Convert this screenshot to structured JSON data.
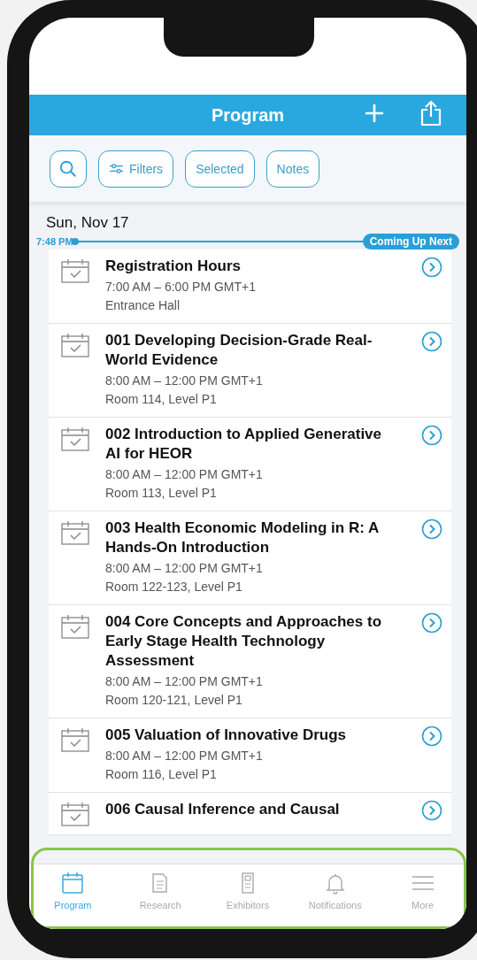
{
  "header": {
    "title": "Program"
  },
  "toolbar": {
    "buttons": [
      {
        "kind": "search"
      },
      {
        "kind": "filters",
        "label": "Filters"
      },
      {
        "kind": "plain",
        "label": "Selected"
      },
      {
        "kind": "plain",
        "label": "Notes"
      }
    ]
  },
  "date": "Sun, Nov 17",
  "now_marker": {
    "time": "7:48 PM",
    "label": "Coming Up Next"
  },
  "sessions": [
    {
      "title": "Registration Hours",
      "time": "7:00 AM – 6:00 PM GMT+1",
      "location": "Entrance Hall"
    },
    {
      "title": "001 Developing Decision-Grade Real-World Evidence",
      "time": "8:00 AM – 12:00 PM GMT+1",
      "location": "Room 114, Level P1"
    },
    {
      "title": "002 Introduction to Applied Generative AI for HEOR",
      "time": "8:00 AM – 12:00 PM GMT+1",
      "location": "Room 113, Level P1"
    },
    {
      "title": "003 Health Economic Modeling in R: A Hands-On Introduction",
      "time": "8:00 AM – 12:00 PM GMT+1",
      "location": "Room 122-123, Level P1"
    },
    {
      "title": "004 Core Concepts and Approaches to Early Stage Health Technology Assessment",
      "time": "8:00 AM – 12:00 PM GMT+1",
      "location": "Room 120-121, Level P1"
    },
    {
      "title": "005 Valuation of Innovative Drugs",
      "time": "8:00 AM – 12:00 PM GMT+1",
      "location": "Room 116, Level P1"
    },
    {
      "title": "006 Causal Inference and Causal"
    }
  ],
  "tabs": [
    {
      "label": "Program",
      "selected": true
    },
    {
      "label": "Research",
      "selected": false
    },
    {
      "label": "Exhibitors",
      "selected": false
    },
    {
      "label": "Notifications",
      "selected": false
    },
    {
      "label": "More",
      "selected": false
    }
  ]
}
